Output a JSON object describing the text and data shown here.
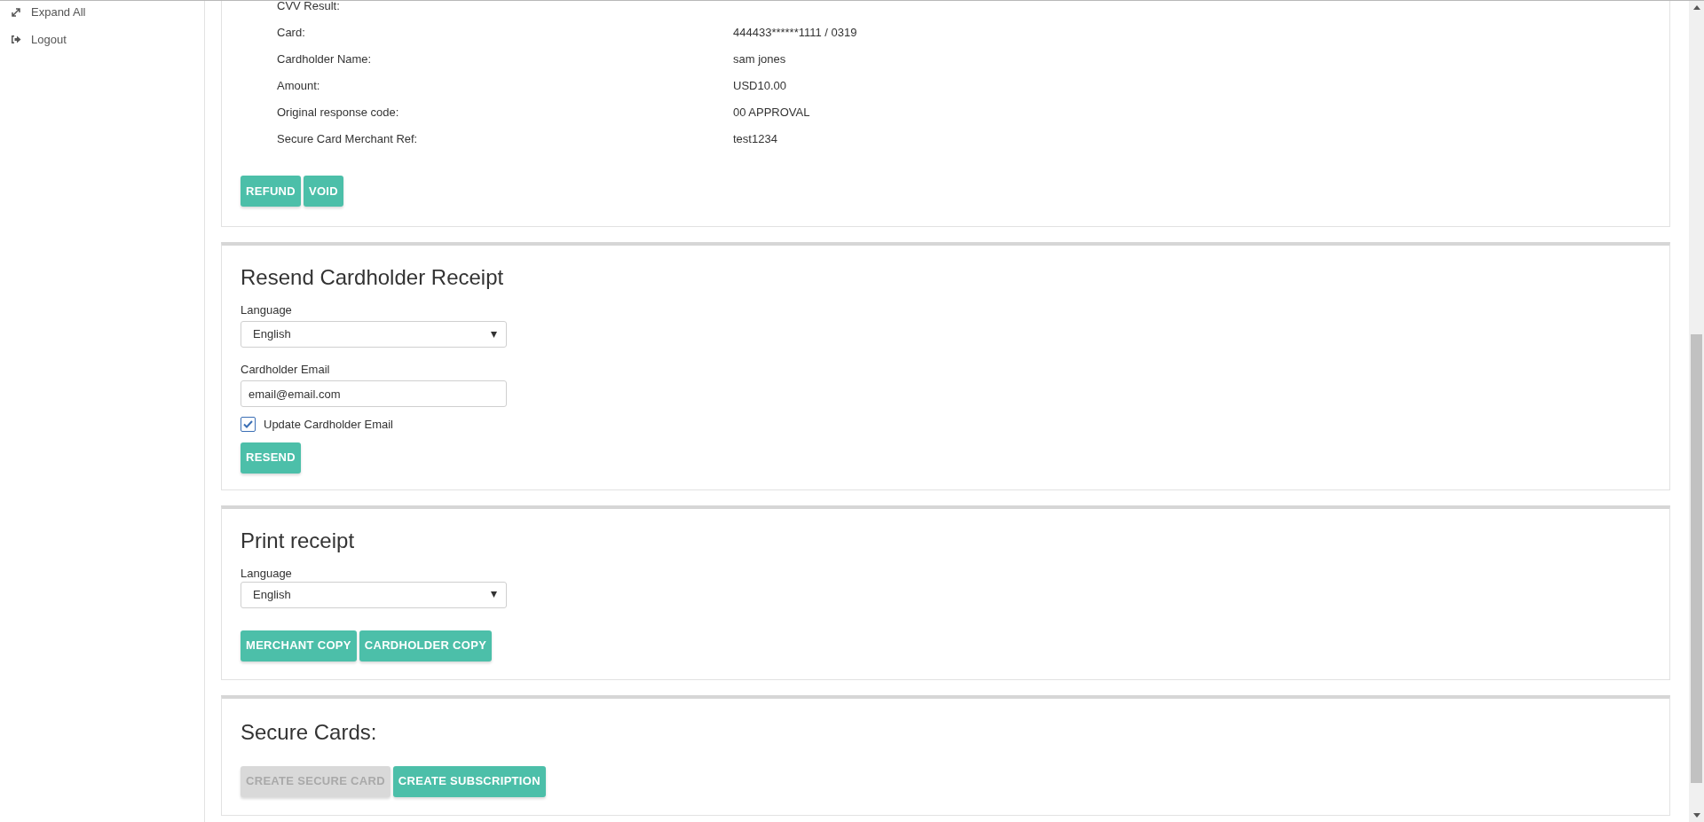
{
  "sidebar": {
    "items": [
      {
        "label": "Expand All"
      },
      {
        "label": "Logout"
      }
    ]
  },
  "details": {
    "rows": [
      {
        "label": "CVV Result:"
      },
      {
        "label": "Card:",
        "value": "444433******1111 / 0319"
      },
      {
        "label": "Cardholder Name:",
        "value": "sam jones"
      },
      {
        "label": "Amount:",
        "value": "USD10.00"
      },
      {
        "label": "Original response code:",
        "value": "00 APPROVAL"
      },
      {
        "label": "Secure Card Merchant Ref:",
        "value": "test1234"
      }
    ],
    "buttons": [
      {
        "label": "REFUND",
        "disabled": false
      },
      {
        "label": "VOID",
        "disabled": false
      }
    ]
  },
  "resend": {
    "title": "Resend Cardholder Receipt",
    "language_label": "Language",
    "language_value": "English",
    "email_label": "Cardholder Email",
    "email_value": "email@email.com",
    "update_email": {
      "label": "Update Cardholder Email",
      "checked": true
    },
    "buttons": [
      {
        "label": "RESEND",
        "disabled": false
      }
    ]
  },
  "print": {
    "title": "Print receipt",
    "language_label": "Language",
    "language_value": "English",
    "buttons": [
      {
        "label": "MERCHANT COPY",
        "disabled": false
      },
      {
        "label": "CARDHOLDER COPY",
        "disabled": false
      }
    ]
  },
  "secure_cards": {
    "title": "Secure Cards:",
    "buttons": [
      {
        "label": "CREATE SECURE CARD",
        "disabled": true
      },
      {
        "label": "CREATE SUBSCRIPTION",
        "disabled": false
      }
    ]
  }
}
